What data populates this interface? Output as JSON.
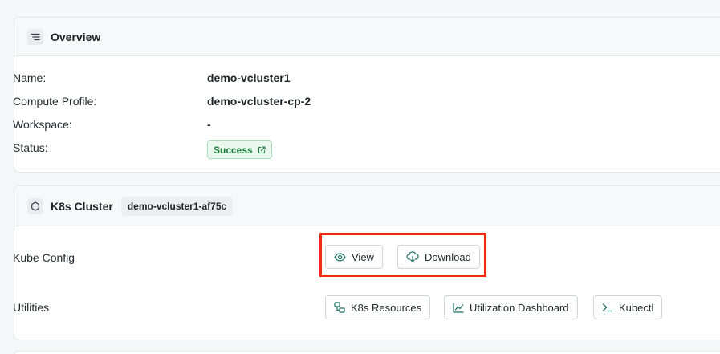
{
  "overview": {
    "title": "Overview",
    "icon": "list-icon",
    "fields": [
      {
        "label": "Name:",
        "value": "demo-vcluster1"
      },
      {
        "label": "Compute Profile:",
        "value": "demo-vcluster-cp-2"
      },
      {
        "label": "Workspace:",
        "value": "-"
      }
    ],
    "status": {
      "label": "Status:",
      "value": "Success",
      "icon": "external-link-icon",
      "color": "#1a7f37"
    }
  },
  "k8s_cluster": {
    "title": "K8s Cluster",
    "icon": "hexagon-icon",
    "cluster_tag": "demo-vcluster1-af75c",
    "kube_config": {
      "label": "Kube Config",
      "view_label": "View",
      "download_label": "Download"
    },
    "utilities": {
      "label": "Utilities",
      "k8s_resources_label": "K8s Resources",
      "utilization_dashboard_label": "Utilization Dashboard",
      "kubectl_label": "Kubectl"
    }
  },
  "colors": {
    "accent": "#1a6e5c",
    "highlight": "#f22b10",
    "success": "#1a7f37"
  }
}
